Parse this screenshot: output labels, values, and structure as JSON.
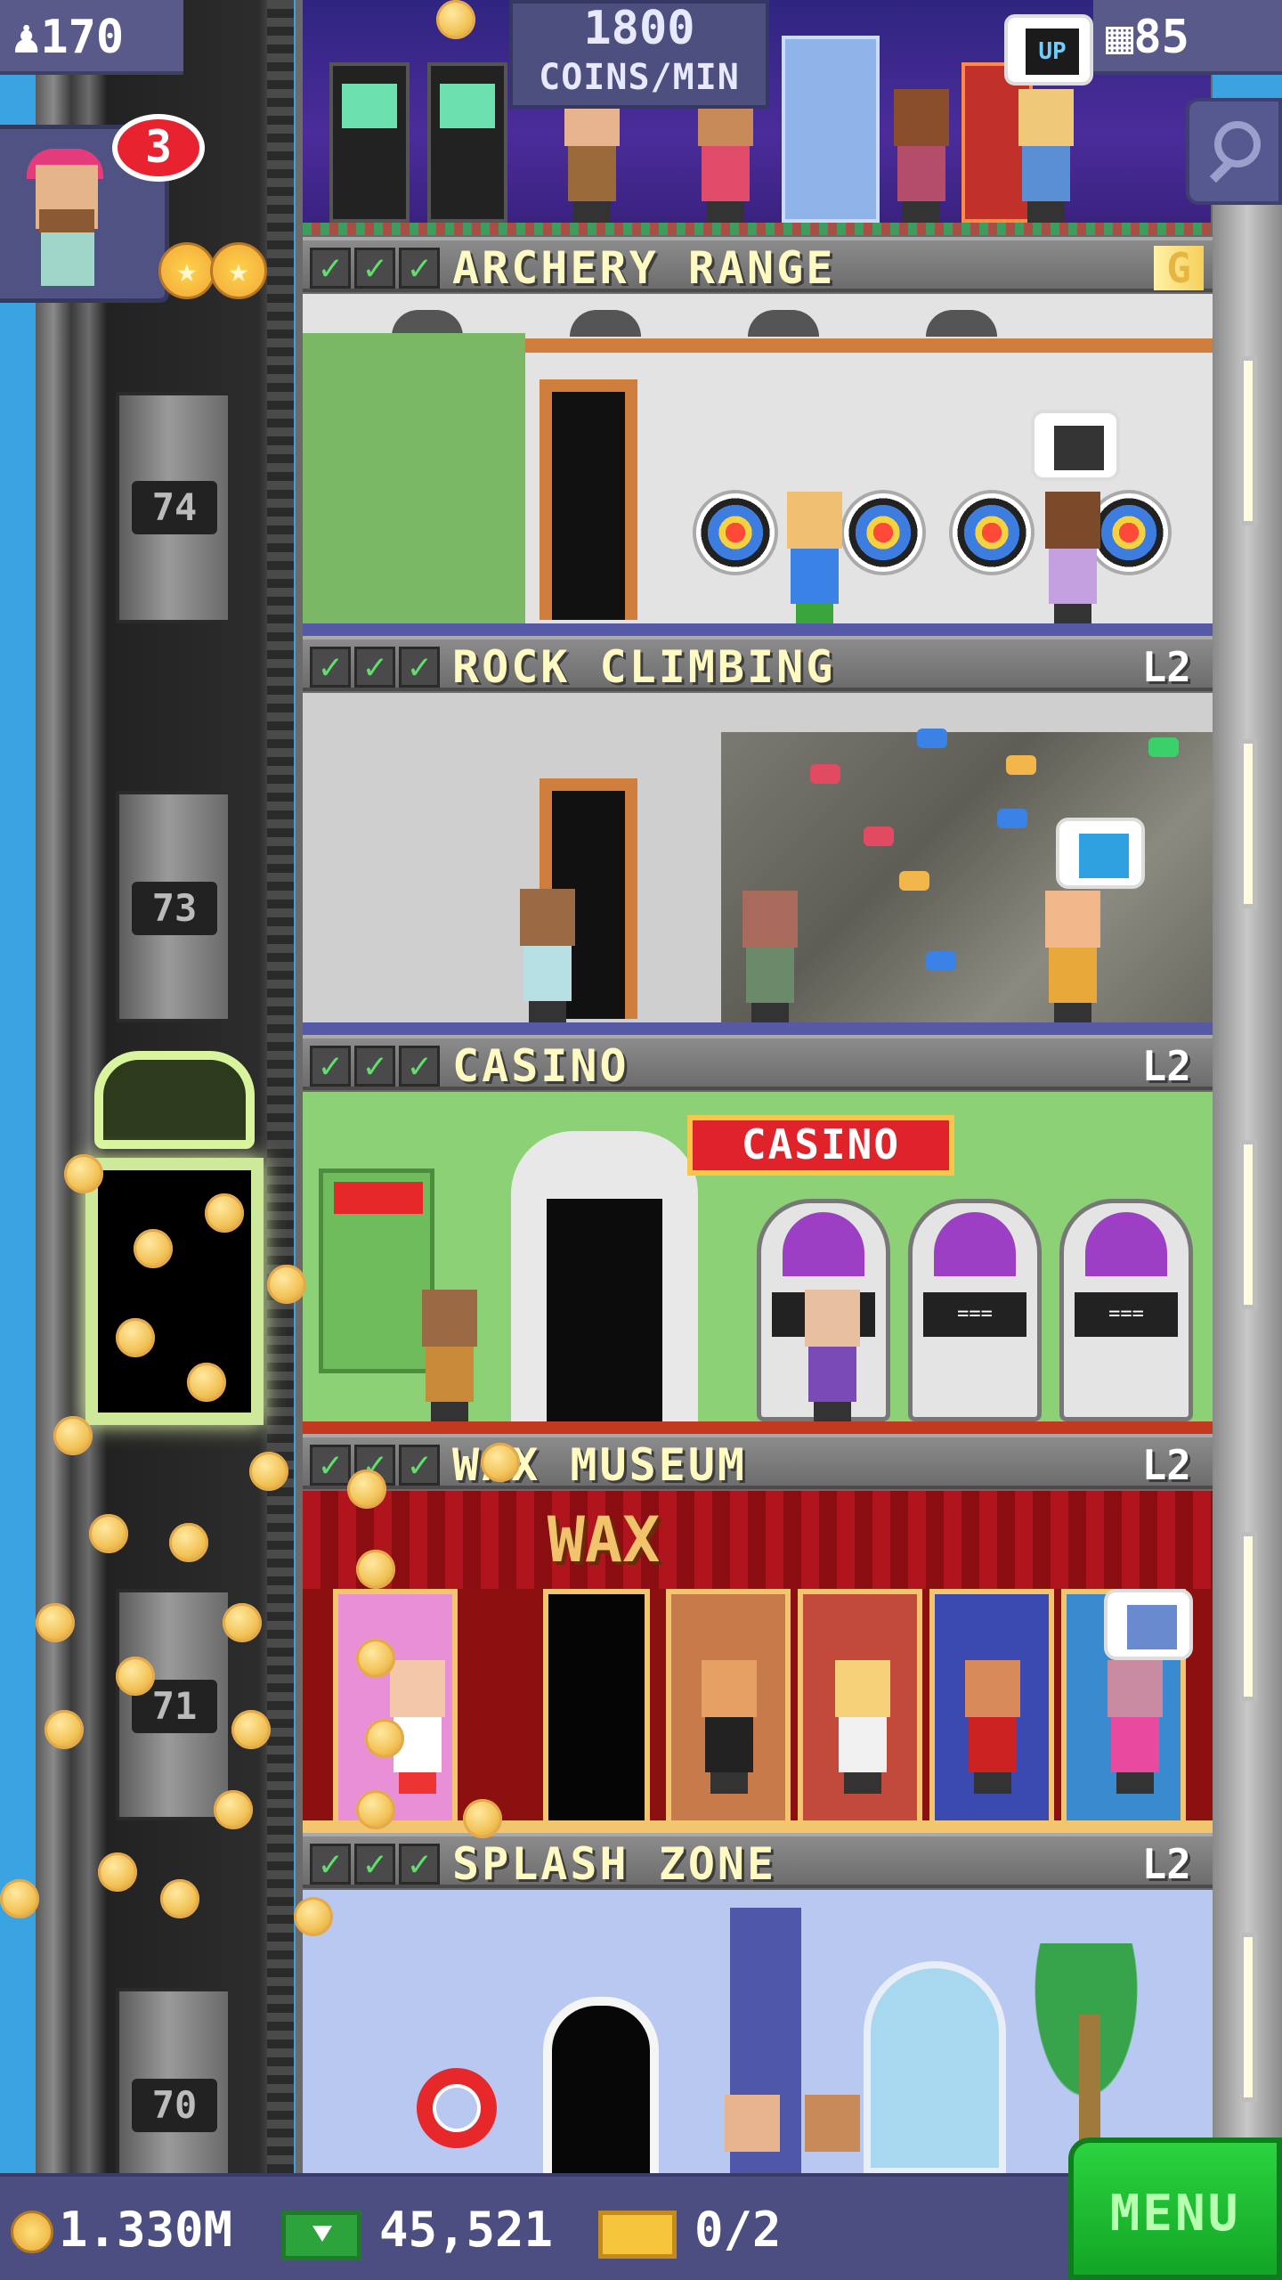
{
  "hud": {
    "population": "170",
    "coins_rate_value": "1800",
    "coins_rate_unit": "COINS/MIN",
    "floors_count": "85",
    "levelup_icon": "UP",
    "visitor_badge": "3"
  },
  "elevator": {
    "floor_labels": [
      "74",
      "73",
      "71",
      "70"
    ]
  },
  "floors": [
    {
      "name": "ARCHERY RANGE",
      "level": "G"
    },
    {
      "name": "ROCK CLIMBING",
      "level": "L2"
    },
    {
      "name": "CASINO",
      "level": "L2"
    },
    {
      "name": "WAX MUSEUM",
      "level": "L2"
    },
    {
      "name": "SPLASH ZONE",
      "level": "L2"
    }
  ],
  "casino_sign": "CASINO",
  "wax_sign": "WAX",
  "bottom_bar": {
    "coins": "1.330M",
    "bux": "45,521",
    "tickets": "0/2",
    "menu_label": "MENU"
  },
  "colors": {
    "hud_bg": "#5a5a8a",
    "header_text": "#fff9c2",
    "check": "#5fe06a",
    "menu_green": "#2bd33f",
    "sky": "#3aa3e0"
  },
  "icons": [
    "population-icon",
    "floors-icon",
    "search-icon",
    "levelup-icon",
    "coin-icon",
    "bux-icon",
    "ticket-icon",
    "star-icon"
  ]
}
